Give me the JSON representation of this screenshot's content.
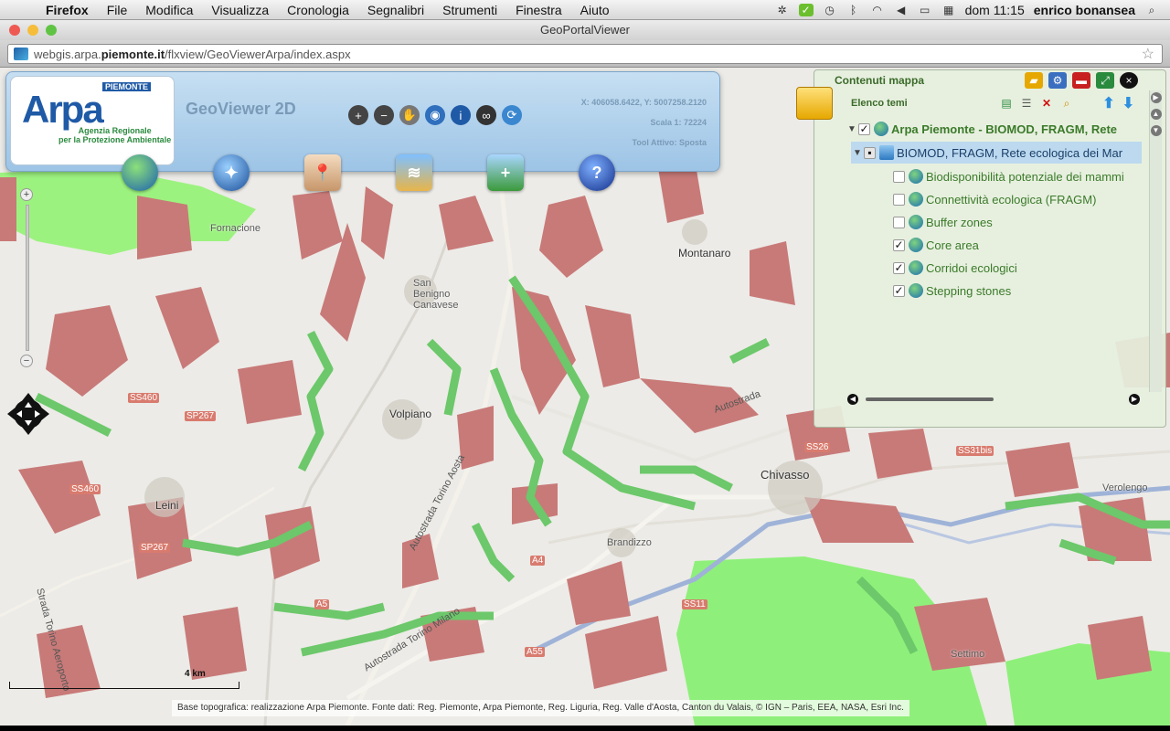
{
  "menubar": {
    "app": "Firefox",
    "items": [
      "File",
      "Modifica",
      "Visualizza",
      "Cronologia",
      "Segnalibri",
      "Strumenti",
      "Finestra",
      "Aiuto"
    ],
    "clock": "dom 11:15",
    "user": "enrico bonansea"
  },
  "browser": {
    "window_title": "GeoPortalViewer",
    "url_prefix": "webgis.arpa.",
    "url_domain": "piemonte.it",
    "url_path": "/flxview/GeoViewerArpa/index.aspx"
  },
  "header": {
    "logo_text": "Arpa",
    "logo_region": "PIEMONTE",
    "logo_agency_line1": "Agenzia Regionale",
    "logo_agency_line2": "per la Protezione Ambientale",
    "app_title": "GeoViewer 2D",
    "coords": "X: 406058.6422, Y: 5007258.2120",
    "scale": "Scala 1: 72224",
    "active_tool": "Tool Attivo: Sposta",
    "tools": [
      "zoom-in-icon",
      "zoom-out-icon",
      "pan-hand-icon",
      "globe-search-icon",
      "info-icon",
      "binoculars-icon",
      "refresh-icon"
    ],
    "big_icons": [
      "globe-icon",
      "compass-icon",
      "map-pin-icon",
      "layers-map-icon",
      "add-layer-icon",
      "help-icon"
    ]
  },
  "layers_panel": {
    "title": "Contenuti mappa",
    "subtitle": "Elenco temi",
    "root_label": "Arpa Piemonte - BIOMOD, FRAGM, Rete",
    "group_label": "BIOMOD, FRAGM, Rete ecologica dei Mar",
    "items": [
      {
        "label": "Biodisponibilità potenziale dei mammi",
        "checked": false
      },
      {
        "label": "Connettività ecologica  (FRAGM)",
        "checked": false
      },
      {
        "label": "Buffer zones",
        "checked": false
      },
      {
        "label": "Core area",
        "checked": true
      },
      {
        "label": "Corridoi ecologici",
        "checked": true
      },
      {
        "label": "Stepping stones",
        "checked": true
      }
    ]
  },
  "map": {
    "places": [
      "Montanaro",
      "San Benigno Canavese",
      "Volpiano",
      "Chivasso",
      "Brandizzo",
      "Verolengo",
      "Leini",
      "Settimo",
      "Fornacione"
    ],
    "road_names": [
      "Autostrada Torino Aosta",
      "Autostrada Torino Milano",
      "Autostrada",
      "Strada Torino Aeroporto"
    ],
    "road_codes": [
      "SS460",
      "SP267",
      "SS460",
      "SP267",
      "A4",
      "A5",
      "SS26",
      "SS31bis",
      "SS11",
      "A55"
    ],
    "scale_label": "4 km",
    "attribution": "Base topografica: realizzazione Arpa Piemonte. Fonte dati: Reg. Piemonte, Arpa Piemonte, Reg. Liguria, Reg. Valle d'Aosta, Canton du Valais, © IGN – Paris, EEA, NASA, Esri Inc."
  },
  "colors": {
    "core_area": "#c87a78",
    "corridors": "#6cc86a",
    "stepping": "#7fea6c",
    "panel_green_text": "#3b7a2a"
  }
}
